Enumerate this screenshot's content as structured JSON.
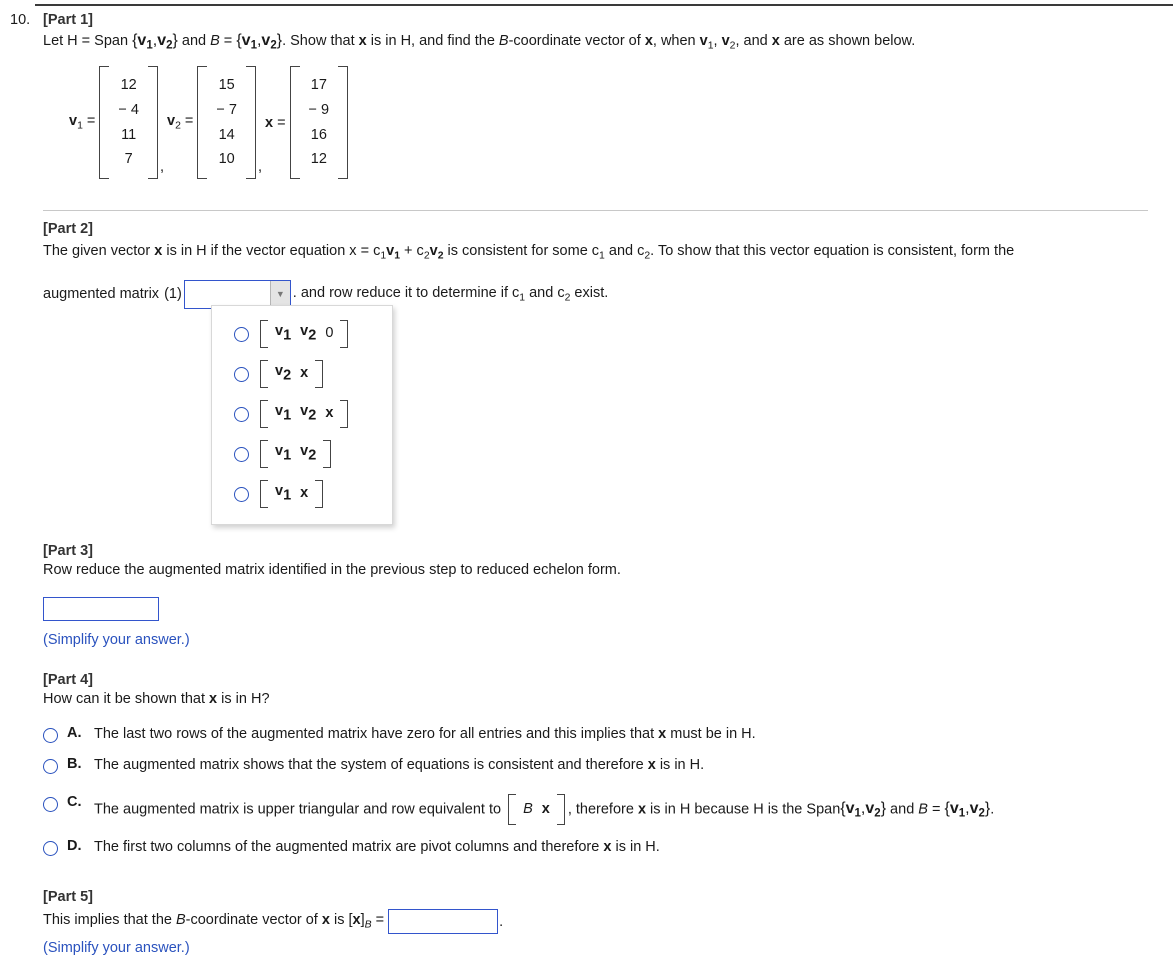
{
  "question_number": "10.",
  "parts": {
    "p1": {
      "heading": "[Part 1]",
      "text_1": "Let H = Span",
      "set_1": "{v1,v2}",
      "text_2": "and B =",
      "set_2": "{v1,v2}",
      "text_3": ". Show that x is in H, and find the B-coordinate vector of x, when v1, v2, and x are as shown below."
    },
    "vectors": {
      "v1": {
        "label": "v",
        "sub": "1",
        "eq": "=",
        "entries": [
          "12",
          "− 4",
          "11",
          "7"
        ]
      },
      "v2": {
        "label": "v",
        "sub": "2",
        "eq": "=",
        "entries": [
          "15",
          "− 7",
          "14",
          "10"
        ]
      },
      "x": {
        "label": "x",
        "sub": "",
        "eq": "=",
        "entries": [
          "17",
          "− 9",
          "16",
          "12"
        ]
      },
      "separator": ","
    },
    "p2": {
      "heading": "[Part 2]",
      "line1_a": "The given vector ",
      "line1_x": "x",
      "line1_b": " is in H if the vector equation x = c",
      "line1_c": "1",
      "line1_d": "v",
      "line1_e": "1",
      "line1_f": " + c",
      "line1_g": "2",
      "line1_h": "v",
      "line1_i": "2",
      "line1_j": " is consistent for some c",
      "line1_k": "1",
      "line1_l": " and c",
      "line1_m": "2",
      "line1_n": ". To show that this vector equation is consistent, form the",
      "line2_a": "augmented matrix",
      "line2_num": "(1)",
      "dropdown_value": "",
      "dropdown_arrow": "▼",
      "line2_b": ". and row reduce it to determine if c",
      "line2_c": "1",
      "line2_d": " and c",
      "line2_e": "2",
      "line2_f": " exist.",
      "options": [
        {
          "cells": [
            "v1",
            "v2",
            "0"
          ]
        },
        {
          "cells": [
            "v2",
            "x"
          ]
        },
        {
          "cells": [
            "v1",
            "v2",
            "x"
          ]
        },
        {
          "cells": [
            "v1",
            "v2"
          ]
        },
        {
          "cells": [
            "v1",
            "x"
          ]
        }
      ]
    },
    "p3": {
      "heading": "[Part 3]",
      "text": "Row reduce the augmented matrix identified in the previous step to reduced echelon form.",
      "input_value": "",
      "note": "(Simplify your answer.)"
    },
    "p4": {
      "heading": "[Part 4]",
      "question_a": "How can it be shown that ",
      "question_x": "x",
      "question_b": " is in H?",
      "choices": [
        {
          "label": "A.",
          "segments": [
            {
              "t": "The last two rows of the augmented matrix have zero for all entries and this implies that "
            },
            {
              "t": "x",
              "b": true
            },
            {
              "t": " must be in H."
            }
          ]
        },
        {
          "label": "B.",
          "segments": [
            {
              "t": "The augmented matrix shows that the system of equations is consistent and therefore "
            },
            {
              "t": "x",
              "b": true
            },
            {
              "t": " is in H."
            }
          ]
        },
        {
          "label": "C.",
          "segments": [
            {
              "t": "The augmented matrix is upper triangular and row equivalent to "
            },
            {
              "m": [
                "B",
                "x"
              ]
            },
            {
              "t": ", therefore "
            },
            {
              "t": "x",
              "b": true
            },
            {
              "t": " is in H because H is the Span"
            },
            {
              "s": "{v1,v2}"
            },
            {
              "t": " and B = "
            },
            {
              "s": "{v1,v2}"
            },
            {
              "t": "."
            }
          ]
        },
        {
          "label": "D.",
          "segments": [
            {
              "t": "The first two columns of the augmented matrix are pivot columns and therefore "
            },
            {
              "t": "x",
              "b": true
            },
            {
              "t": " is in H."
            }
          ]
        }
      ]
    },
    "p5": {
      "heading": "[Part 5]",
      "text_a": "This implies that the ",
      "text_B": "B",
      "text_b": "-coordinate vector of ",
      "text_x": "x",
      "text_c": " is [",
      "text_x2": "x",
      "text_d": "]",
      "text_sub": "B",
      "text_eq": " =",
      "input_value": "",
      "period": ".",
      "note": "(Simplify your answer.)"
    }
  },
  "colors": {
    "accent_blue": "#2a52be",
    "input_border": "#3355cc",
    "rule": "#c8c8c8"
  }
}
